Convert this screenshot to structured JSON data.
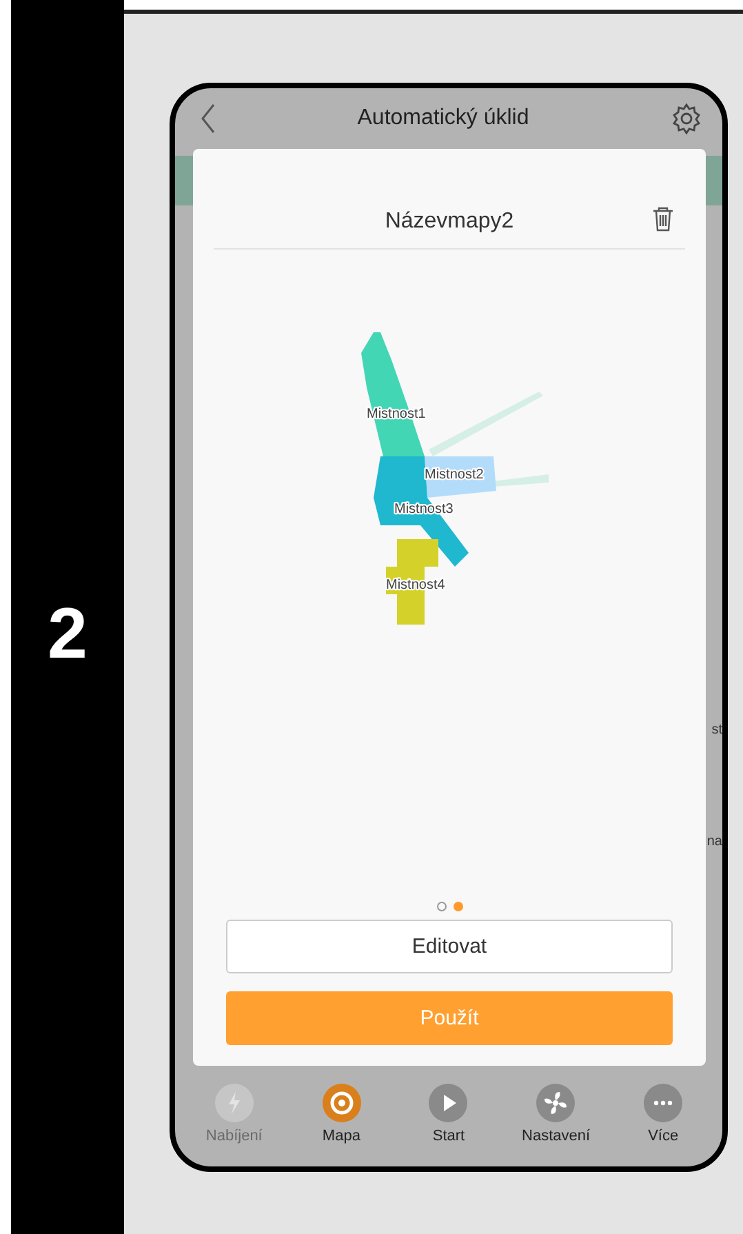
{
  "step": {
    "number": "2"
  },
  "app": {
    "title": "Automatický úklid",
    "map_name": "Názevmapy2",
    "background_fragments": [
      "st",
      "na"
    ],
    "rooms": [
      {
        "label": "Mistnost1",
        "color": "#43d6b5"
      },
      {
        "label": "Mistnost2",
        "color": "#b3dcfb"
      },
      {
        "label": "Mistnost3",
        "color": "#1fb8cf"
      },
      {
        "label": "Mistnost4",
        "color": "#d4d22a"
      }
    ],
    "pager": [
      {
        "selected": false
      },
      {
        "selected": true
      }
    ],
    "buttons": [
      {
        "label": "Editovat",
        "kind": "outline"
      },
      {
        "label": "Použít",
        "kind": "primary"
      }
    ],
    "tabs": [
      {
        "label": "Nabíjení",
        "kind": "charge",
        "selected": false,
        "disabled": true
      },
      {
        "label": "Mapa",
        "kind": "map",
        "selected": true,
        "disabled": false
      },
      {
        "label": "Start",
        "kind": "start",
        "selected": false,
        "disabled": false
      },
      {
        "label": "Nastavení",
        "kind": "fan",
        "selected": false,
        "disabled": false
      },
      {
        "label": "Více",
        "kind": "more",
        "selected": false,
        "disabled": false
      }
    ]
  }
}
